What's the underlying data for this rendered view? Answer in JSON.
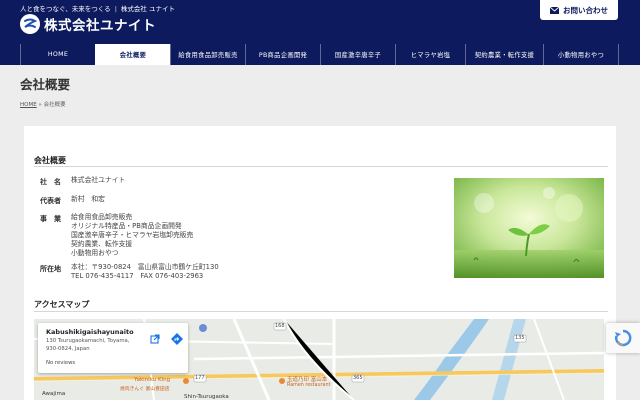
{
  "header": {
    "tagline_left": "人と食をつなぐ、未来をつくる",
    "tagline_right": "株式会社 ユナイト",
    "logo_text": "株式会社ユナイト",
    "contact_label": "お問い合わせ"
  },
  "nav": {
    "items": [
      {
        "label": "HOME"
      },
      {
        "label": "会社概要"
      },
      {
        "label": "給食用食品卸売販売"
      },
      {
        "label": "PB商品企画開発"
      },
      {
        "label": "国産激辛唐辛子"
      },
      {
        "label": "ヒマラヤ岩塩"
      },
      {
        "label": "契約農業・転作支援"
      },
      {
        "label": "小動物用おやつ"
      }
    ],
    "active_index": 1
  },
  "page": {
    "title": "会社概要",
    "breadcrumb_home": "HOME",
    "breadcrumb_sep": "»",
    "breadcrumb_current": "会社概要"
  },
  "company": {
    "section_title": "会社概要",
    "rows": [
      {
        "label": "社　名",
        "lines": [
          "株式会社ユナイト"
        ]
      },
      {
        "label": "代表者",
        "lines": [
          "新村　和宏"
        ]
      },
      {
        "label": "事　業",
        "lines": [
          "給食用食品卸売販売",
          "オリジナル特産品・PB商品企画開発",
          "国産激辛唐辛子・ヒマラヤ岩塩卸売販売",
          "契約農業、転作支援",
          "小動物用おやつ"
        ]
      },
      {
        "label": "所在地",
        "lines": [
          "本社：〒930-0824　富山県富山市鶴ケ丘町130",
          "TEL 076-435-4117　FAX 076-403-2963"
        ]
      }
    ]
  },
  "access": {
    "section_title": "アクセスマップ",
    "map_card": {
      "title": "Kabushikigaishayunaito",
      "address": "130 Tsurugaokamachi, Toyama, 930-0824, Japan",
      "reviews": "No reviews"
    },
    "map_labels": {
      "restaurant_1": "Yakiniku King",
      "restaurant_1_sub": "焼肉きんぐ 富山豊田店",
      "restaurant_2": "玉道乃印 富山本",
      "restaurant_2_sub": "Ramen restaurant",
      "area": "Awajima",
      "area_2": "Shin-Tsurugaoka",
      "road_1": "177",
      "road_2": "365",
      "road_3": "135",
      "road_4": "168"
    }
  },
  "colors": {
    "brand_navy": "#0d1b5e",
    "page_bg": "#ededed",
    "map_water": "#9cc9e8",
    "map_road": "#f7c85c"
  },
  "icons": {
    "contact": "mail-icon",
    "logo": "unite-logo-mark",
    "map_open": "external-link-icon",
    "map_directions": "directions-icon",
    "recaptcha": "recaptcha-icon"
  }
}
